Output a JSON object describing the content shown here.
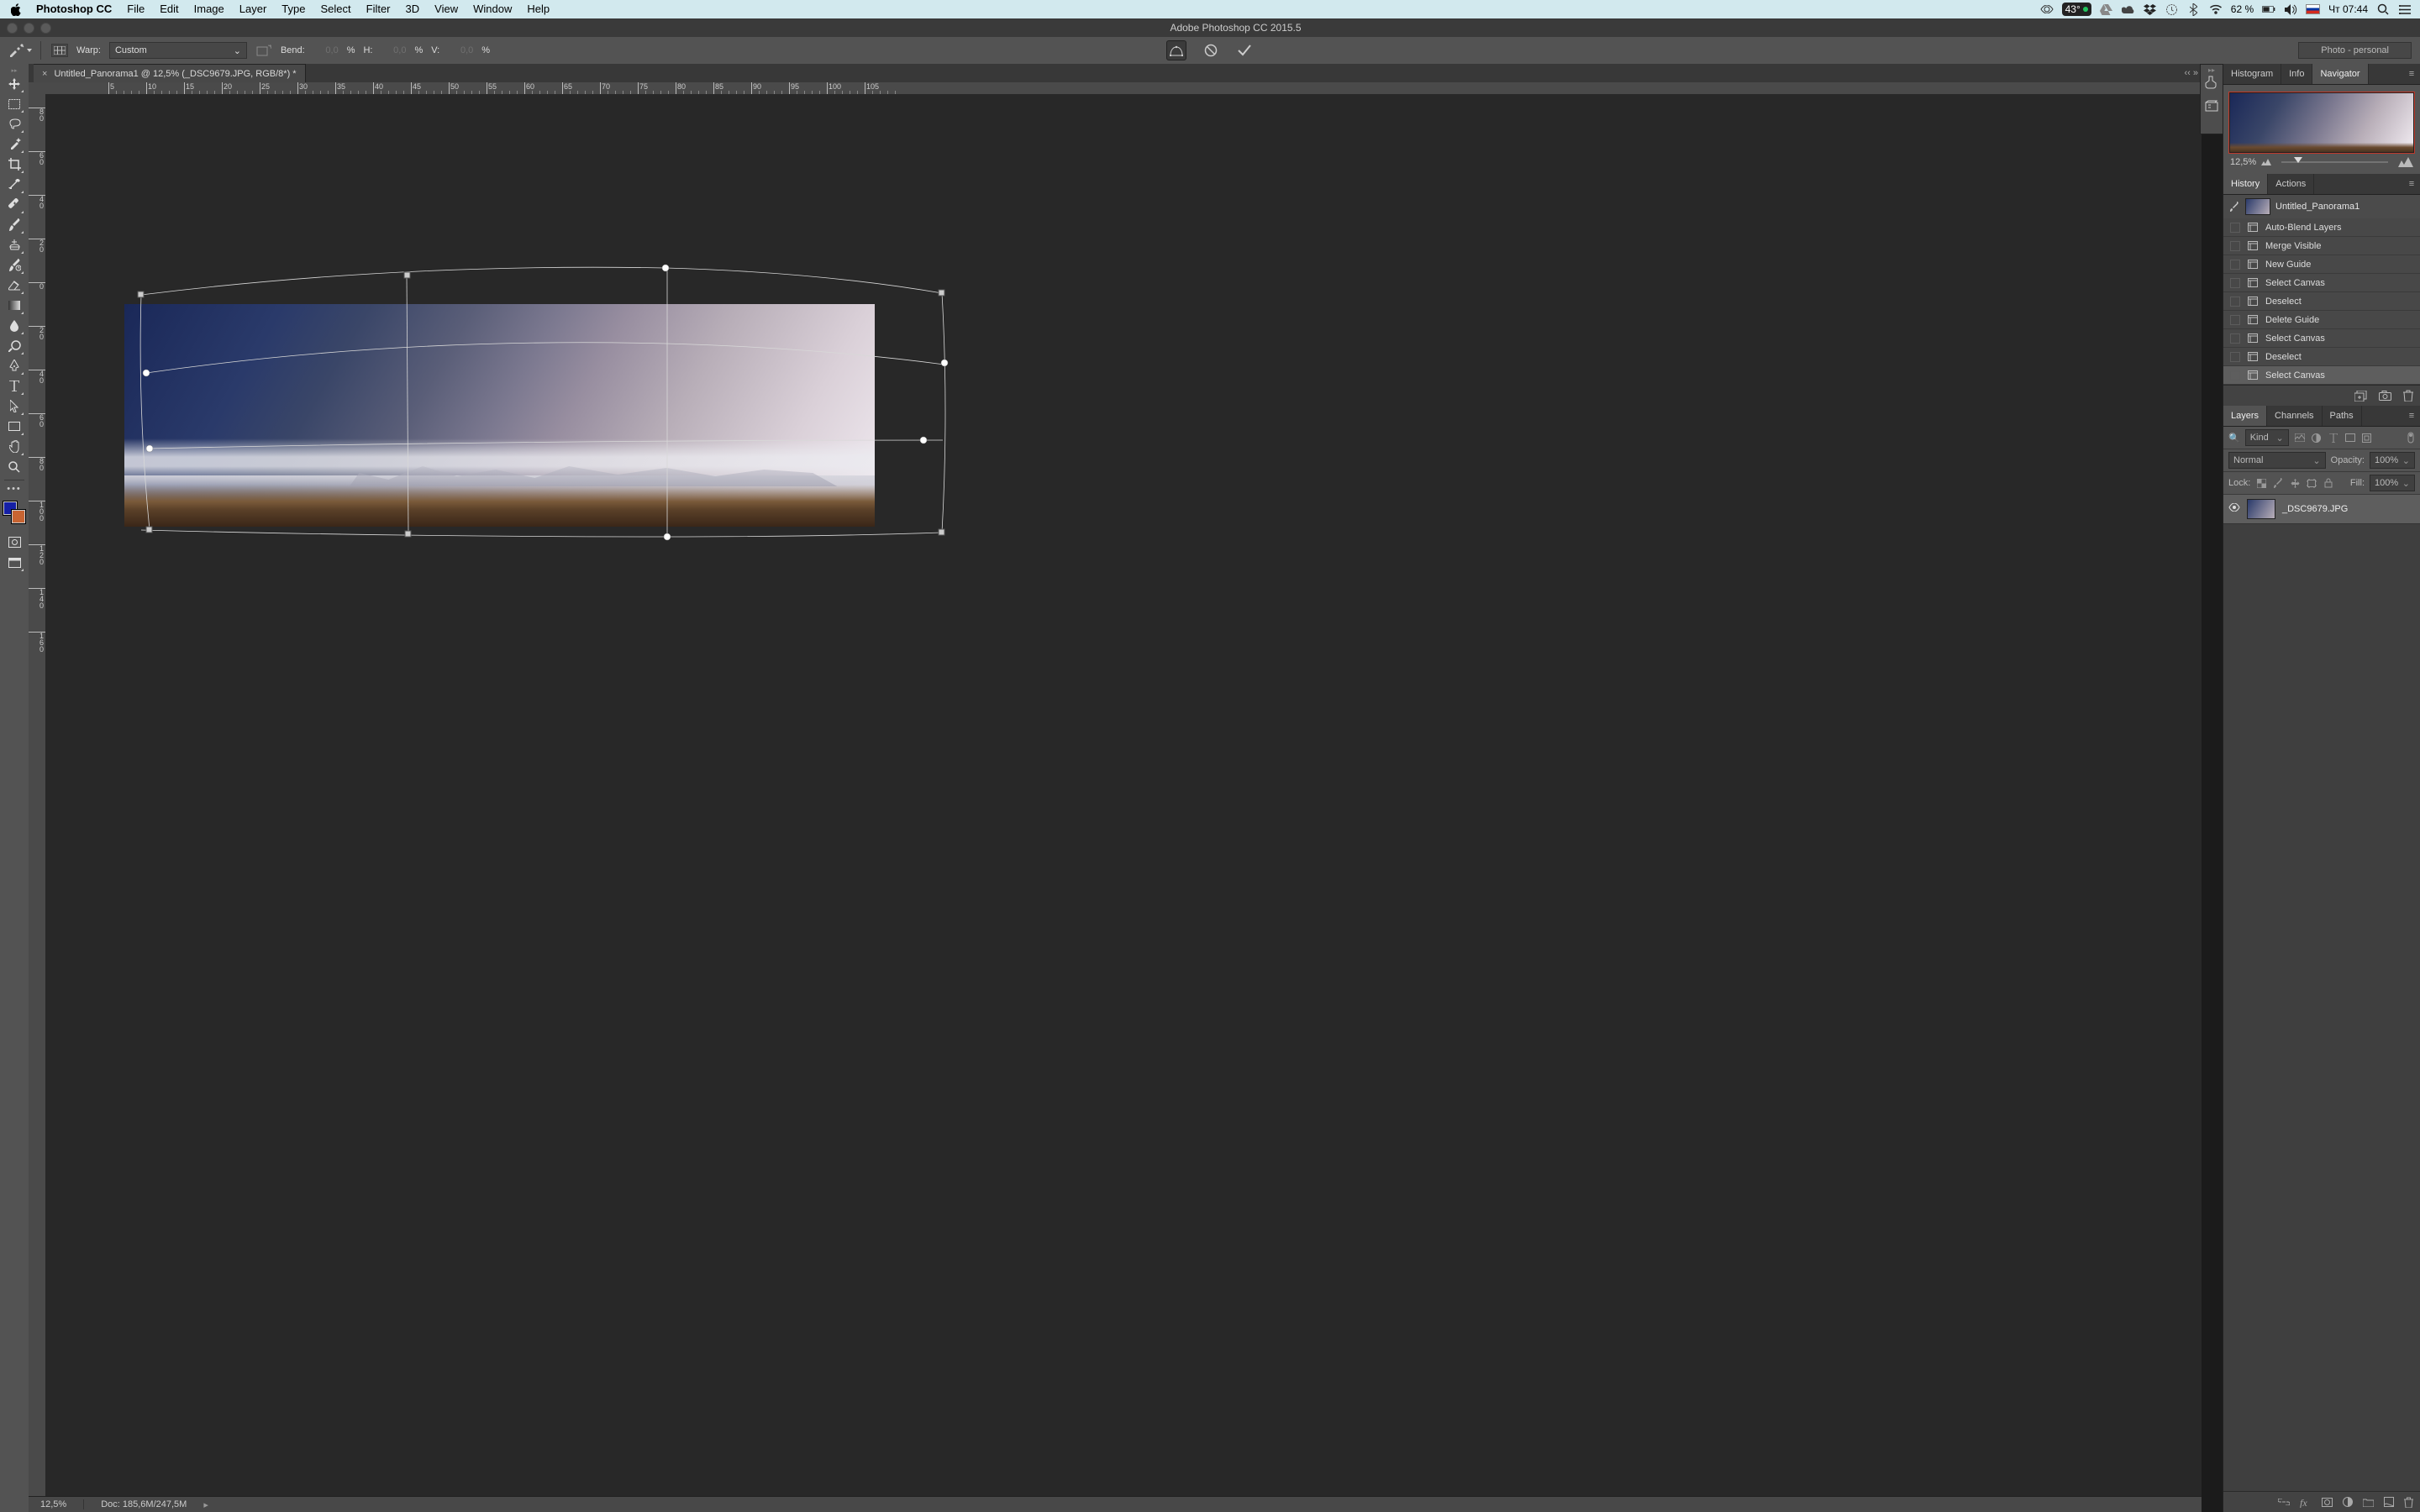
{
  "menubar": {
    "app": "Photoshop CC",
    "items": [
      "File",
      "Edit",
      "Image",
      "Layer",
      "Type",
      "Select",
      "Filter",
      "3D",
      "View",
      "Window",
      "Help"
    ],
    "tray": {
      "temp": "43°",
      "battery_pct": "62 %",
      "clock": "Чт 07:44"
    }
  },
  "window_title": "Adobe Photoshop CC 2015.5",
  "options": {
    "warp_label": "Warp:",
    "warp_style": "Custom",
    "bend_label": "Bend:",
    "bend_value": "0,0",
    "pct": "%",
    "h_label": "H:",
    "h_value": "0,0",
    "v_label": "V:",
    "v_value": "0,0",
    "workspace": "Photo - personal"
  },
  "document": {
    "tab_title": "Untitled_Panorama1 @ 12,5% (_DSC9679.JPG, RGB/8*) *"
  },
  "ruler": {
    "h_labels": [
      "5",
      "10",
      "15",
      "20",
      "25",
      "30",
      "35",
      "40",
      "45",
      "50",
      "55",
      "60",
      "65",
      "70",
      "75",
      "80",
      "85",
      "90",
      "95",
      "100",
      "105"
    ],
    "v_labels": [
      "0",
      "2",
      "0",
      "4",
      "0",
      "6",
      "0",
      "8",
      "0",
      "1",
      "0",
      "0",
      "1",
      "2",
      "0",
      "1",
      "4",
      "0",
      "1",
      "6",
      "0"
    ]
  },
  "status": {
    "zoom": "12,5%",
    "doc": "Doc: 185,6M/247,5M"
  },
  "panels": {
    "nav_tabs": [
      "Histogram",
      "Info",
      "Navigator"
    ],
    "nav_zoom": "12,5%",
    "history_tabs": [
      "History",
      "Actions"
    ],
    "history_source": "Untitled_Panorama1",
    "history": [
      "Auto-Blend Layers",
      "Merge Visible",
      "New Guide",
      "Select Canvas",
      "Deselect",
      "Delete Guide",
      "Select Canvas",
      "Deselect",
      "Select Canvas"
    ],
    "layers_tabs": [
      "Layers",
      "Channels",
      "Paths"
    ],
    "layers": {
      "filter_placeholder": "Kind",
      "blend_mode": "Normal",
      "opacity_label": "Opacity:",
      "opacity_value": "100%",
      "lock_label": "Lock:",
      "fill_label": "Fill:",
      "fill_value": "100%",
      "layer_name": "_DSC9679.JPG"
    }
  }
}
